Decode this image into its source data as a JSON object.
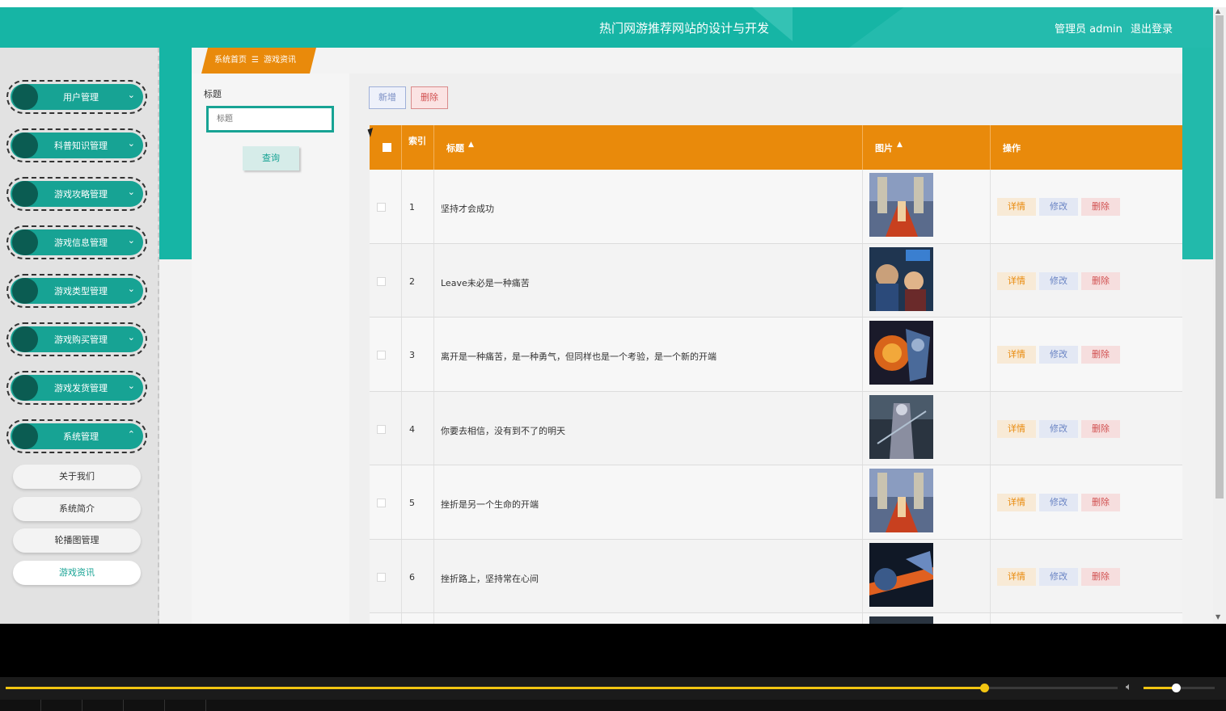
{
  "header": {
    "title": "热门网游推荐网站的设计与开发",
    "user_text": "管理员 admin",
    "logout": "退出登录"
  },
  "sidebar": {
    "menus": [
      {
        "label": "用户管理",
        "chevron": "chevron-down-icon"
      },
      {
        "label": "科普知识管理",
        "chevron": "chevron-down-icon"
      },
      {
        "label": "游戏攻略管理",
        "chevron": "chevron-down-icon"
      },
      {
        "label": "游戏信息管理",
        "chevron": "chevron-down-icon"
      },
      {
        "label": "游戏类型管理",
        "chevron": "chevron-down-icon"
      },
      {
        "label": "游戏购买管理",
        "chevron": "chevron-down-icon"
      },
      {
        "label": "游戏发货管理",
        "chevron": "chevron-down-icon"
      },
      {
        "label": "系统管理",
        "chevron": "chevron-up-icon"
      }
    ],
    "submenu": [
      {
        "label": "关于我们",
        "active": false
      },
      {
        "label": "系统简介",
        "active": false
      },
      {
        "label": "轮播图管理",
        "active": false
      },
      {
        "label": "游戏资讯",
        "active": true
      }
    ]
  },
  "breadcrumb": {
    "home": "系统首页",
    "separator": "☰",
    "current": "游戏资讯"
  },
  "search": {
    "label": "标题",
    "placeholder": "标题",
    "query_button": "查询"
  },
  "toolbar": {
    "add_label": "新增",
    "delete_label": "删除"
  },
  "table": {
    "columns": {
      "index": "索引",
      "title": "标题",
      "image": "图片",
      "actions": "操作"
    },
    "sort_icon": "sort-icon",
    "rows": [
      {
        "index": "1",
        "title": "坚持才会成功",
        "image": "game-thumbnail"
      },
      {
        "index": "2",
        "title": "Leave未必是一种痛苦",
        "image": "game-thumbnail"
      },
      {
        "index": "3",
        "title": "离开是一种痛苦，是一种勇气，但同样也是一个考验，是一个新的开端",
        "image": "game-thumbnail"
      },
      {
        "index": "4",
        "title": "你要去相信，没有到不了的明天",
        "image": "game-thumbnail"
      },
      {
        "index": "5",
        "title": "挫折是另一个生命的开端",
        "image": "game-thumbnail"
      },
      {
        "index": "6",
        "title": "挫折路上，坚持常在心间",
        "image": "game-thumbnail"
      }
    ],
    "action_labels": {
      "detail": "详情",
      "edit": "修改",
      "remove": "删除"
    }
  },
  "player": {
    "progress": 0.88,
    "volume": 0.45,
    "accent_color": "#f2c511"
  },
  "colors": {
    "primary": "#16b5a5",
    "accent": "#e98a0b",
    "danger": "#d15050"
  }
}
